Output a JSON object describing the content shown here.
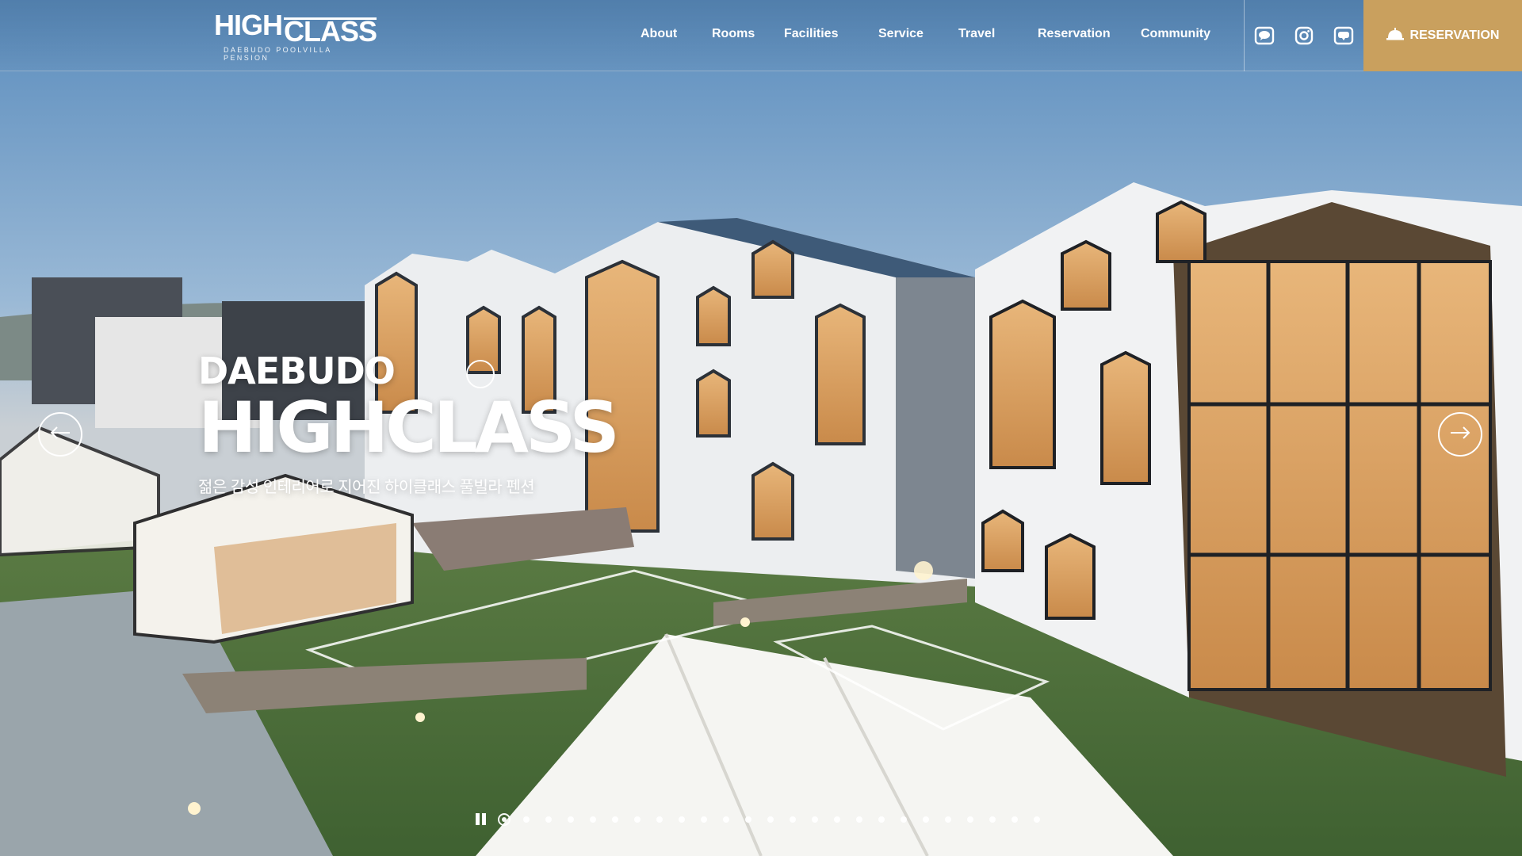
{
  "brand": {
    "logo_high": "HIGH",
    "logo_class": "CLASS",
    "logo_sub": "DAEBUDO POOLVILLA PENSION"
  },
  "nav": {
    "items": [
      {
        "label": "About"
      },
      {
        "label": "Rooms"
      },
      {
        "label": "Facilities"
      },
      {
        "label": "Service"
      },
      {
        "label": "Travel"
      },
      {
        "label": "Reservation"
      },
      {
        "label": "Community"
      }
    ],
    "social": [
      {
        "icon": "talk-icon"
      },
      {
        "icon": "instagram-icon"
      },
      {
        "icon": "blog-icon"
      }
    ],
    "reservation_button": "RESERVATION",
    "accent_color": "#c9a05e"
  },
  "hero": {
    "subtitle": "DAEBUDO",
    "title": "HIGHCLASS",
    "description": "젊은 감성 인테리어로 지어진 하이클래스 풀빌라 펜션"
  },
  "slider": {
    "total_slides": 25,
    "active_index": 1,
    "paused": false
  }
}
